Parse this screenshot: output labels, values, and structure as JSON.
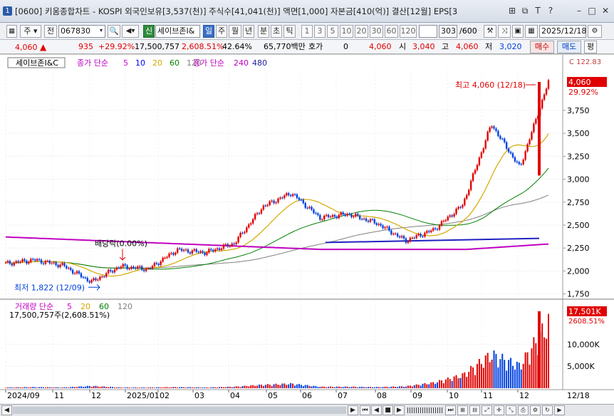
{
  "window": {
    "icon_label": "1",
    "title": "[0600] 키움종합차트 - KOSPI 외국인보유[3,537(천)] 주식수[41,041(천)] 액면[1,000] 자본금[410(억)] 결산[12월] EPS[3",
    "controls": [
      "⊞",
      "⧉",
      "T",
      "?",
      "–",
      "□",
      "✕"
    ]
  },
  "toolbar": {
    "period_type": "주",
    "all_label": "전",
    "stock_code": "067830",
    "new_label": "신",
    "stock_name": "세이브존I&",
    "intervals": [
      "일",
      "주",
      "월",
      "년",
      "분",
      "초",
      "틱"
    ],
    "selected_interval": "일",
    "numbers": [
      "1",
      "3",
      "5",
      "10",
      "20",
      "30",
      "60",
      "120"
    ],
    "count": "303",
    "count_total": "/600",
    "date": "2025/12/18"
  },
  "info": {
    "price": "4,060",
    "change": "935",
    "change_pct": "+29.92%",
    "volume": "17,500,757",
    "volume_pct": "2,608.51%",
    "turnover": "42.64%",
    "amount": "65,770백만",
    "hoga_label": "호가",
    "hoga_value": "0",
    "price2": "4,060",
    "open_label": "시",
    "open": "3,040",
    "high_label": "고",
    "high": "4,060",
    "low_label": "저",
    "low": "3,020",
    "buy_label": "매수",
    "sell_label": "매도",
    "eval_label": "평"
  },
  "legend": {
    "stock": "세이브존I&C",
    "ma_price_label": "종가 단순",
    "ma_price_periods": [
      "5",
      "10",
      "20",
      "60",
      "120"
    ],
    "ma_price_colors": [
      "#d000d0",
      "#0000ff",
      "#d4a800",
      "#008000",
      "#808080"
    ],
    "ma_long_label": "종가 단순",
    "ma_long_periods": [
      "240",
      "480"
    ],
    "ma_long_colors": [
      "#c000c0",
      "#2020a0"
    ],
    "vol_label": "거래량 단순",
    "vol_periods": [
      "5",
      "20",
      "60",
      "120"
    ],
    "vol_colors": [
      "#d000d0",
      "#d4a800",
      "#008000",
      "#808080"
    ],
    "vol_value": "17,500,757주(2,608.51%)"
  },
  "annotations": {
    "high": "최고 4,060 (12/18)",
    "low": "최저 1,822 (12/09)",
    "dividend": "배당락(0.00%)"
  },
  "price_axis_labels": [
    "3,750",
    "3,500",
    "3,250",
    "3,000",
    "2,750",
    "2,500",
    "2,250",
    "2,000",
    "1,750"
  ],
  "price_axis_top": "C 122.83",
  "price_tag": "4,060",
  "price_tag_pct": "29.92%",
  "volume_axis_labels": [
    "10,000K",
    "5,000K"
  ],
  "volume_tag": "17,501K",
  "volume_tag_pct": "2608.51%",
  "date_axis_labels": [
    "2024/09",
    "11",
    "12",
    "2025/01",
    "02",
    "03",
    "04",
    "05",
    "06",
    "07",
    "08",
    "09",
    "10",
    "11",
    "12"
  ],
  "date_axis_end": "12/18",
  "scroll_buttons": [
    "◀",
    "▶",
    "⏮",
    "◀",
    "■",
    "▶",
    "⏭"
  ],
  "colors": {
    "up": "#e00000",
    "down": "#0040e0",
    "accent": "#3b6fc6"
  },
  "chart_data": {
    "type": "candlestick",
    "price_range": [
      1700,
      4200
    ],
    "volume_range": [
      0,
      17501
    ],
    "close_dates": [
      "2024/09",
      "2024/10",
      "2024/11",
      "2024/12",
      "2025/01",
      "2025/02",
      "2025/03",
      "2025/04",
      "2025/05",
      "2025/06",
      "2025/07",
      "2025/08",
      "2025/09",
      "2025/10",
      "2025/11",
      "2025/12/01",
      "2025/12/08",
      "2025/12/12",
      "2025/12/16",
      "2025/12/18"
    ],
    "closes": [
      2080,
      2120,
      2060,
      1880,
      2050,
      2020,
      2230,
      2200,
      2300,
      2700,
      2850,
      2580,
      2620,
      2520,
      2330,
      2450,
      2720,
      3600,
      3125,
      4060
    ],
    "volume_k": [
      200,
      300,
      200,
      600,
      200,
      200,
      300,
      200,
      400,
      900,
      1200,
      400,
      400,
      300,
      500,
      1500,
      3500,
      9000,
      6000,
      17501
    ]
  }
}
